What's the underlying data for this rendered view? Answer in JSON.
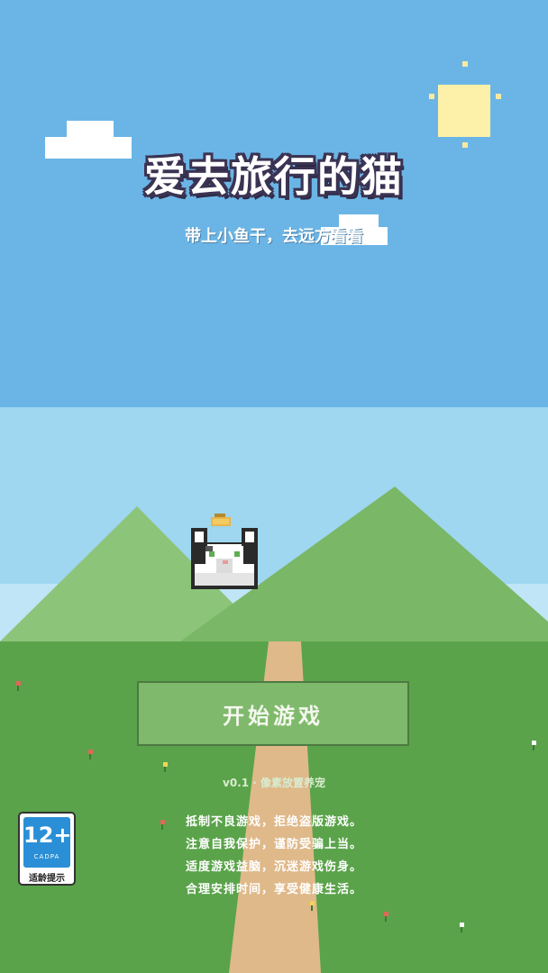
{
  "game": {
    "title": "爱去旅行的猫",
    "subtitle": "带上小鱼干，去远方看看"
  },
  "menu": {
    "start_label": "开始游戏"
  },
  "footer": {
    "version": "v0.1 · 像素放置养宠",
    "notice_lines": [
      "抵制不良游戏，拒绝盗版游戏。",
      "注意自我保护，谨防受骗上当。",
      "适度游戏益脑，沉迷游戏伤身。",
      "合理安排时间，享受健康生活。"
    ]
  },
  "age_rating": {
    "label": "12+",
    "org": "CADPA",
    "tip": "适龄提示"
  },
  "colors": {
    "sky": "#6bb5e6",
    "grass": "#5aa34a",
    "mountain_left": "#8cc57a",
    "mountain_right": "#7ab766",
    "path": "#dfb98a",
    "button": "#7fb96b"
  }
}
